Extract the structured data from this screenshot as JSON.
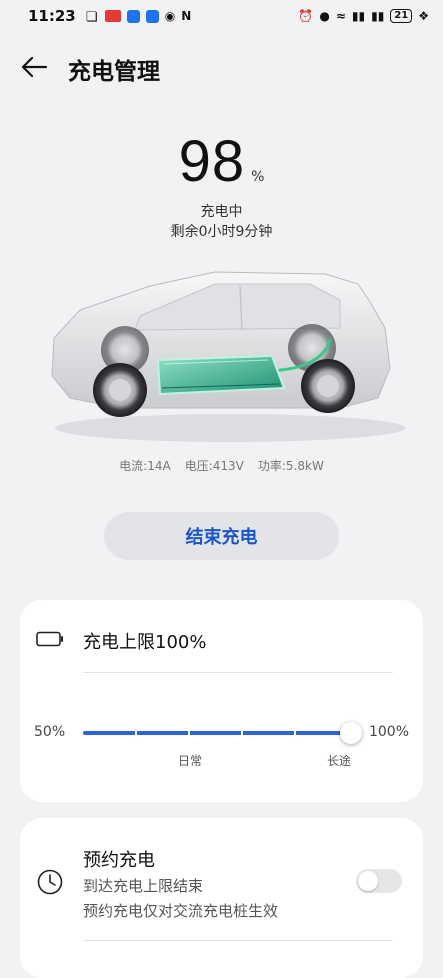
{
  "status_bar": {
    "time": "11:23",
    "battery_level": "21"
  },
  "header": {
    "title": "充电管理"
  },
  "charge": {
    "percent": "98",
    "unit": "%",
    "status": "充电中",
    "remaining": "剩余0小时9分钟"
  },
  "metrics": {
    "current": "电流:14A",
    "voltage": "电压:413V",
    "power": "功率:5.8kW"
  },
  "actions": {
    "end_charge_label": "结束充电"
  },
  "charge_limit": {
    "title": "充电上限100%",
    "min_label": "50%",
    "max_label": "100%",
    "value_percent": 100,
    "preset_daily": "日常",
    "preset_long": "长途"
  },
  "schedule": {
    "title": "预约充电",
    "subtitle_line1": "到达充电上限结束",
    "subtitle_line2": "预约充电仅对交流充电桩生效",
    "enabled": false
  },
  "colors": {
    "accent": "#1a56c9",
    "slider": "#2a64d8",
    "battery_glow": "#35c98a",
    "background": "#f1f2f4"
  }
}
